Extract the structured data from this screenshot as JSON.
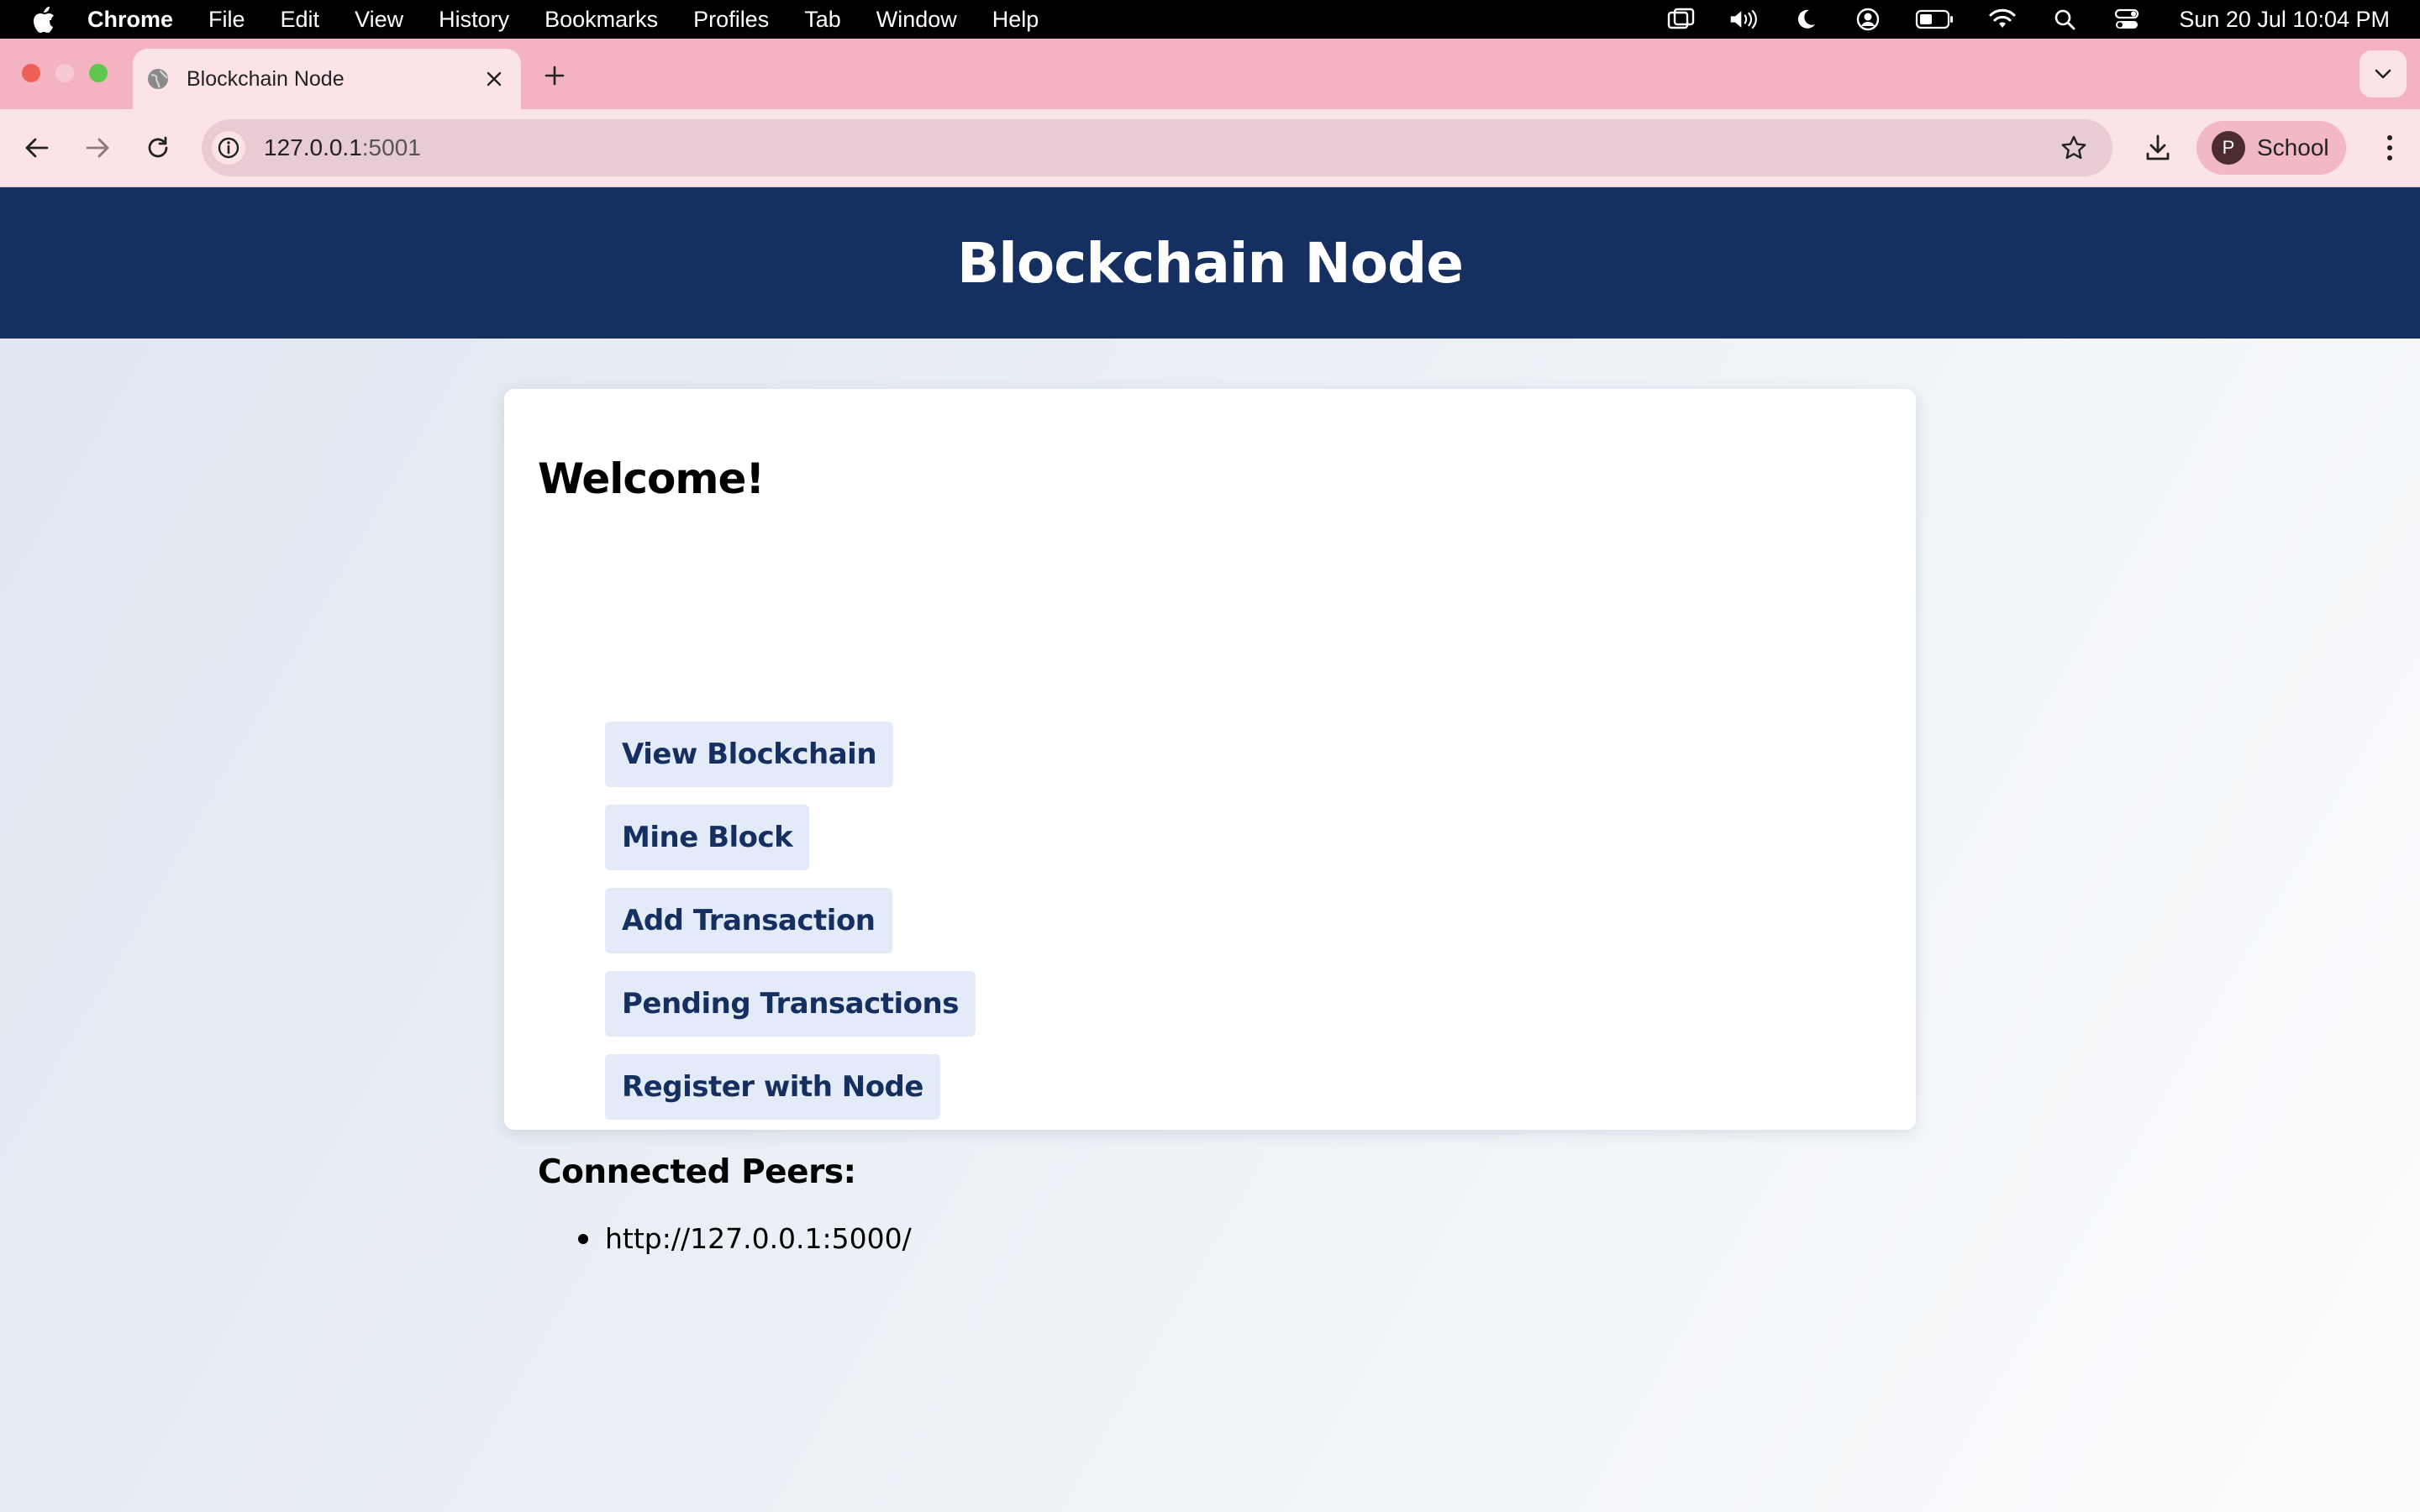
{
  "menubar": {
    "app_name": "Chrome",
    "items": [
      "File",
      "Edit",
      "View",
      "History",
      "Bookmarks",
      "Profiles",
      "Tab",
      "Window",
      "Help"
    ],
    "clock": "Sun 20 Jul  10:04 PM"
  },
  "browser": {
    "tab_title": "Blockchain Node",
    "url_host": "127.0.0.1",
    "url_port": ":5001",
    "profile_initial": "P",
    "profile_name": "School"
  },
  "page": {
    "header_title": "Blockchain Node",
    "welcome": "Welcome!",
    "buttons": [
      "View Blockchain",
      "Mine Block",
      "Add Transaction",
      "Pending Transactions",
      "Register with Node"
    ],
    "peers_heading": "Connected Peers:",
    "peers": [
      "http://127.0.0.1:5000/"
    ]
  },
  "colors": {
    "header_bg": "#142f60",
    "button_bg": "#e4ebf8",
    "button_text": "#142f60",
    "tabstrip_bg": "#f4b3c0"
  }
}
